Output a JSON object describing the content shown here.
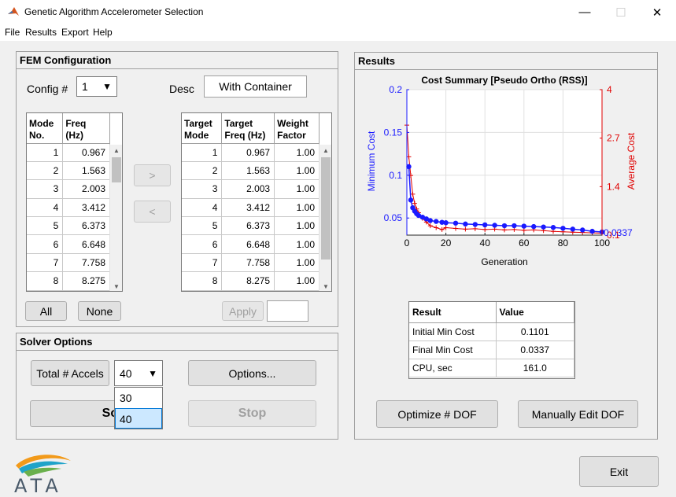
{
  "window": {
    "title": "Genetic Algorithm Accelerometer Selection"
  },
  "menu": [
    "File",
    "Results",
    "Export",
    "Help"
  ],
  "fem": {
    "title": "FEM Configuration",
    "config_label": "Config #",
    "config_value": "1",
    "desc_label": "Desc",
    "desc_value": "With Container",
    "left_table": {
      "headers": [
        [
          "Mode",
          "No."
        ],
        [
          "Freq",
          "(Hz)"
        ]
      ],
      "rows": [
        [
          "1",
          "0.967"
        ],
        [
          "2",
          "1.563"
        ],
        [
          "3",
          "2.003"
        ],
        [
          "4",
          "3.412"
        ],
        [
          "5",
          "6.373"
        ],
        [
          "6",
          "6.648"
        ],
        [
          "7",
          "7.758"
        ],
        [
          "8",
          "8.275"
        ]
      ]
    },
    "right_table": {
      "headers": [
        [
          "Target",
          "Mode"
        ],
        [
          "Target",
          "Freq (Hz)"
        ],
        [
          "Weight",
          "Factor"
        ]
      ],
      "rows": [
        [
          "1",
          "0.967",
          "1.00"
        ],
        [
          "2",
          "1.563",
          "1.00"
        ],
        [
          "3",
          "2.003",
          "1.00"
        ],
        [
          "4",
          "3.412",
          "1.00"
        ],
        [
          "5",
          "6.373",
          "1.00"
        ],
        [
          "6",
          "6.648",
          "1.00"
        ],
        [
          "7",
          "7.758",
          "1.00"
        ],
        [
          "8",
          "8.275",
          "1.00"
        ]
      ]
    },
    "add_label": ">",
    "remove_label": "<",
    "all_label": "All",
    "none_label": "None",
    "apply_label": "Apply",
    "apply_value": ""
  },
  "solver": {
    "title": "Solver Options",
    "total_accels_label": "Total # Accels",
    "accels_value": "40",
    "accels_options": [
      "30",
      "40"
    ],
    "accels_selected": "40",
    "options_label": "Options...",
    "solve_label": "Solve",
    "stop_label": "Stop"
  },
  "results": {
    "title": "Results",
    "table_headers": [
      "Result",
      "Value"
    ],
    "table_rows": [
      [
        "Initial Min Cost",
        "0.1101"
      ],
      [
        "Final Min Cost",
        "0.0337"
      ],
      [
        "CPU, sec",
        "161.0"
      ]
    ],
    "optimize_label": "Optimize # DOF",
    "manual_label": "Manually Edit DOF"
  },
  "footer": {
    "exit_label": "Exit",
    "logo_text": "ATA"
  },
  "colors": {
    "min_cost": "#1a1aff",
    "avg_cost": "#e00000"
  },
  "chart_data": {
    "type": "line",
    "title": "Cost Summary [Pseudo Ortho (RSS)]",
    "xlabel": "Generation",
    "ylabel_left": "Minimum Cost",
    "ylabel_right": "Average Cost",
    "xlim": [
      0,
      100
    ],
    "ylim_left": [
      0.03,
      0.2
    ],
    "ylim_right": [
      0.1,
      4
    ],
    "x_ticks": [
      "0",
      "20",
      "40",
      "60",
      "80",
      "100"
    ],
    "y_ticks_left": [
      "0.05",
      "0.1",
      "0.15",
      "0.2"
    ],
    "y_ticks_right": [
      "0.1",
      "1.4",
      "2.7",
      "4"
    ],
    "end_label_left": "0.0337",
    "grid": true,
    "series": [
      {
        "axis": "left",
        "x": [
          1,
          2,
          3,
          4,
          5,
          6,
          8,
          10,
          12,
          15,
          18,
          20,
          25,
          30,
          35,
          40,
          45,
          50,
          55,
          60,
          65,
          70,
          75,
          80,
          85,
          90,
          95,
          100
        ],
        "y": [
          0.1101,
          0.071,
          0.062,
          0.058,
          0.055,
          0.053,
          0.051,
          0.049,
          0.047,
          0.046,
          0.045,
          0.0445,
          0.044,
          0.043,
          0.0425,
          0.042,
          0.0415,
          0.041,
          0.041,
          0.0405,
          0.04,
          0.0395,
          0.039,
          0.038,
          0.037,
          0.036,
          0.0345,
          0.0337
        ]
      },
      {
        "axis": "right",
        "x": [
          0,
          1,
          2,
          3,
          4,
          5,
          6,
          8,
          10,
          12,
          15,
          18,
          20,
          25,
          30,
          35,
          40,
          45,
          50,
          55,
          60,
          65,
          70,
          75,
          80,
          85,
          90,
          95,
          100
        ],
        "y": [
          3.05,
          2.2,
          1.7,
          1.2,
          0.95,
          0.8,
          0.7,
          0.55,
          0.45,
          0.35,
          0.3,
          0.25,
          0.3,
          0.28,
          0.26,
          0.27,
          0.25,
          0.26,
          0.24,
          0.25,
          0.23,
          0.24,
          0.22,
          0.2,
          0.19,
          0.18,
          0.17,
          0.16,
          0.15
        ]
      }
    ]
  }
}
